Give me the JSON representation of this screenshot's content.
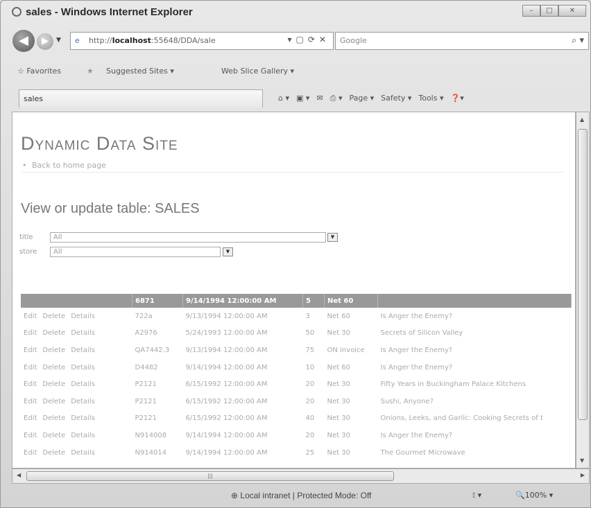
{
  "window": {
    "title": "sales - Windows Internet Explorer"
  },
  "nav": {
    "address": {
      "prefix": "http://",
      "host": "localhost",
      "rest": ":55648/DDA/sale"
    },
    "search_provider": "Google"
  },
  "favorites": {
    "label": "Favorites",
    "items": [
      "Suggested Sites",
      "Web Slice Gallery"
    ]
  },
  "tab": {
    "label": "sales"
  },
  "commandbar": {
    "items": [
      "Page",
      "Safety",
      "Tools"
    ]
  },
  "page": {
    "site_title": "Dynamic Data Site",
    "back_link": "Back to home page",
    "heading": "View or update table: SALES",
    "filters": [
      {
        "label": "title",
        "value": "All"
      },
      {
        "label": "store",
        "value": "All"
      }
    ]
  },
  "grid": {
    "columns": [
      "",
      "6871",
      "9/14/1994 12:00:00 AM",
      "5",
      "Net 60",
      ""
    ],
    "actions": [
      "Edit",
      "Delete",
      "Details"
    ],
    "rows": [
      [
        "722a",
        "9/13/1994 12:00:00 AM",
        "3",
        "Net 60",
        "Is Anger the Enemy?"
      ],
      [
        "A2976",
        "5/24/1993 12:00:00 AM",
        "50",
        "Net 30",
        "Secrets of Silicon Valley"
      ],
      [
        "QA7442.3",
        "9/13/1994 12:00:00 AM",
        "75",
        "ON invoice",
        "Is Anger the Enemy?"
      ],
      [
        "D4482",
        "9/14/1994 12:00:00 AM",
        "10",
        "Net 60",
        "Is Anger the Enemy?"
      ],
      [
        "P2121",
        "6/15/1992 12:00:00 AM",
        "20",
        "Net 30",
        "Fifty Years in Buckingham Palace Kitchens"
      ],
      [
        "P2121",
        "6/15/1992 12:00:00 AM",
        "20",
        "Net 30",
        "Sushi, Anyone?"
      ],
      [
        "P2121",
        "6/15/1992 12:00:00 AM",
        "40",
        "Net 30",
        "Onions, Leeks, and Garlic: Cooking Secrets of t"
      ],
      [
        "N914008",
        "9/14/1994 12:00:00 AM",
        "20",
        "Net 30",
        "Is Anger the Enemy?"
      ],
      [
        "N914014",
        "9/14/1994 12:00:00 AM",
        "25",
        "Net 30",
        "The Gourmet Microwave"
      ]
    ]
  },
  "status": {
    "zone": "Local intranet | Protected Mode: Off",
    "zoom": "100%"
  }
}
